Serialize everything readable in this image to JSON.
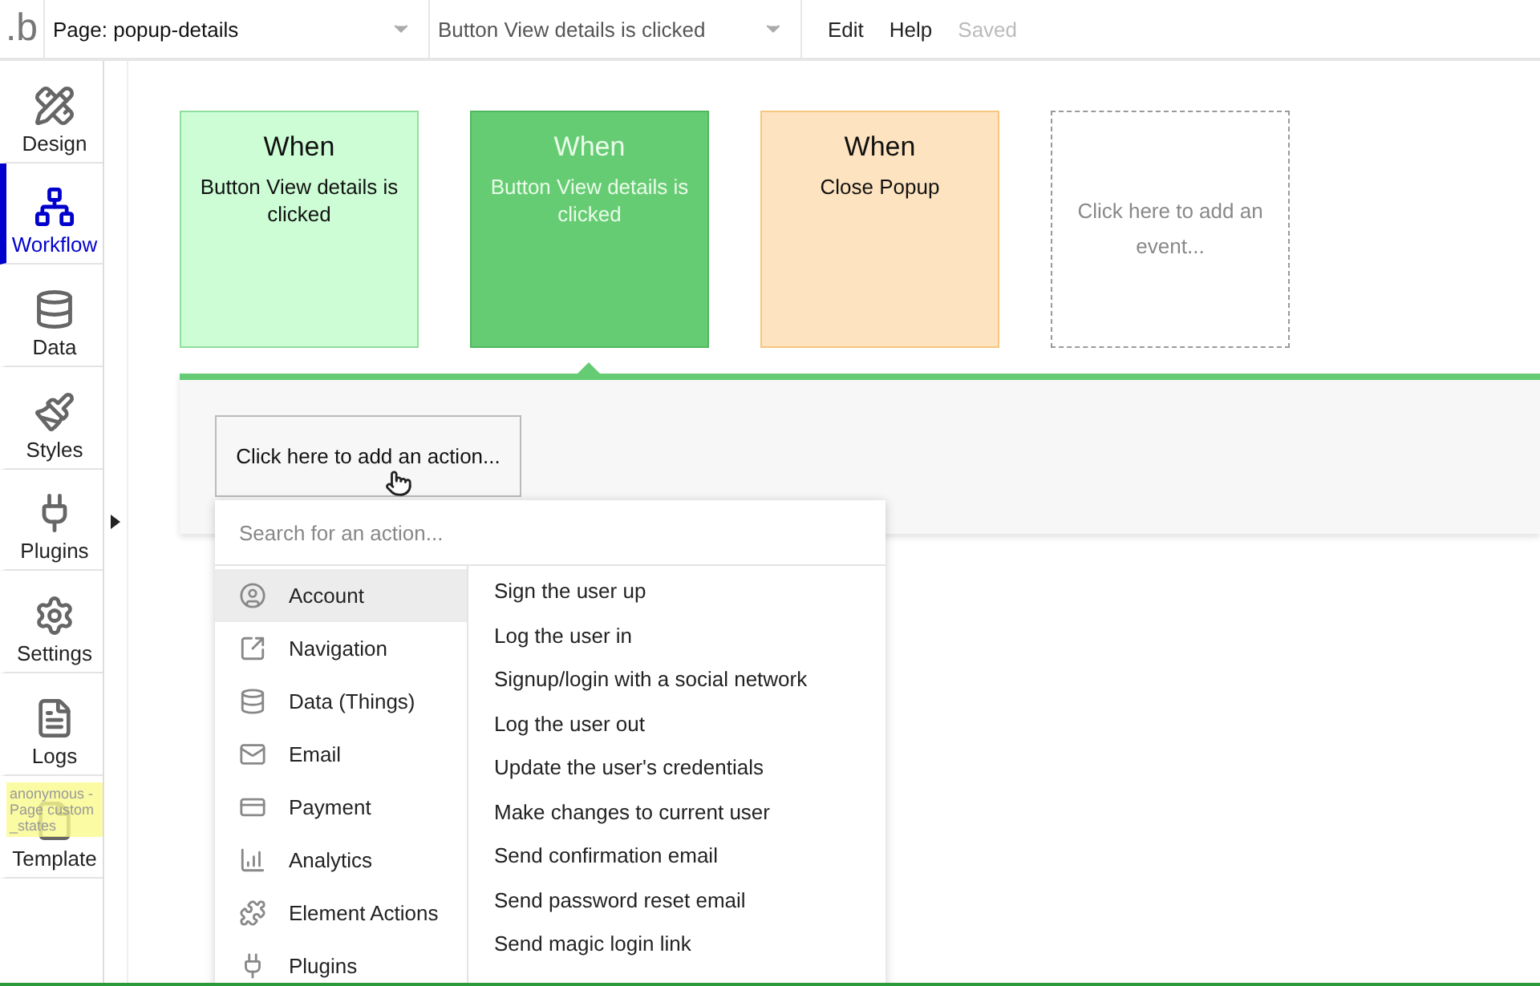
{
  "topbar": {
    "logo": ".b",
    "page_select": "Page: popup-details",
    "event_select": "Button View details is clicked",
    "menu": [
      {
        "label": "Edit",
        "disabled": false
      },
      {
        "label": "Help",
        "disabled": false
      },
      {
        "label": "Saved",
        "disabled": true
      }
    ]
  },
  "sidebar": {
    "items": [
      {
        "label": "Design",
        "selected": false
      },
      {
        "label": "Workflow",
        "selected": true
      },
      {
        "label": "Data",
        "selected": false
      },
      {
        "label": "Styles",
        "selected": false
      },
      {
        "label": "Plugins",
        "selected": false
      },
      {
        "label": "Settings",
        "selected": false
      },
      {
        "label": "Logs",
        "selected": false
      },
      {
        "label": "Template",
        "selected": false
      }
    ],
    "note": "anonymous - Page custom_states"
  },
  "events": [
    {
      "kind": "event",
      "title": "When",
      "text": "Button View details is clicked",
      "color": "#ccfdd5",
      "selected": false
    },
    {
      "kind": "event",
      "title": "When",
      "text": "Button View details is clicked",
      "color": "#66cc74",
      "selected": true
    },
    {
      "kind": "event",
      "title": "When",
      "text": "Close Popup",
      "color": "#fde3bf",
      "selected": false
    },
    {
      "kind": "add",
      "text": "Click here to add an event..."
    }
  ],
  "action_button": "Click here to add an action...",
  "action_menu": {
    "search": {
      "placeholder": "Search for an action..."
    },
    "categories": [
      {
        "label": "Account",
        "selected": true
      },
      {
        "label": "Navigation",
        "selected": false
      },
      {
        "label": "Data (Things)",
        "selected": false
      },
      {
        "label": "Email",
        "selected": false
      },
      {
        "label": "Payment",
        "selected": false
      },
      {
        "label": "Analytics",
        "selected": false
      },
      {
        "label": "Element Actions",
        "selected": false
      },
      {
        "label": "Plugins",
        "selected": false
      }
    ],
    "actions": [
      "Sign the user up",
      "Log the user in",
      "Signup/login with a social network",
      "Log the user out",
      "Update the user's credentials",
      "Make changes to current user",
      "Send confirmation email",
      "Send password reset email",
      "Send magic login link"
    ]
  }
}
